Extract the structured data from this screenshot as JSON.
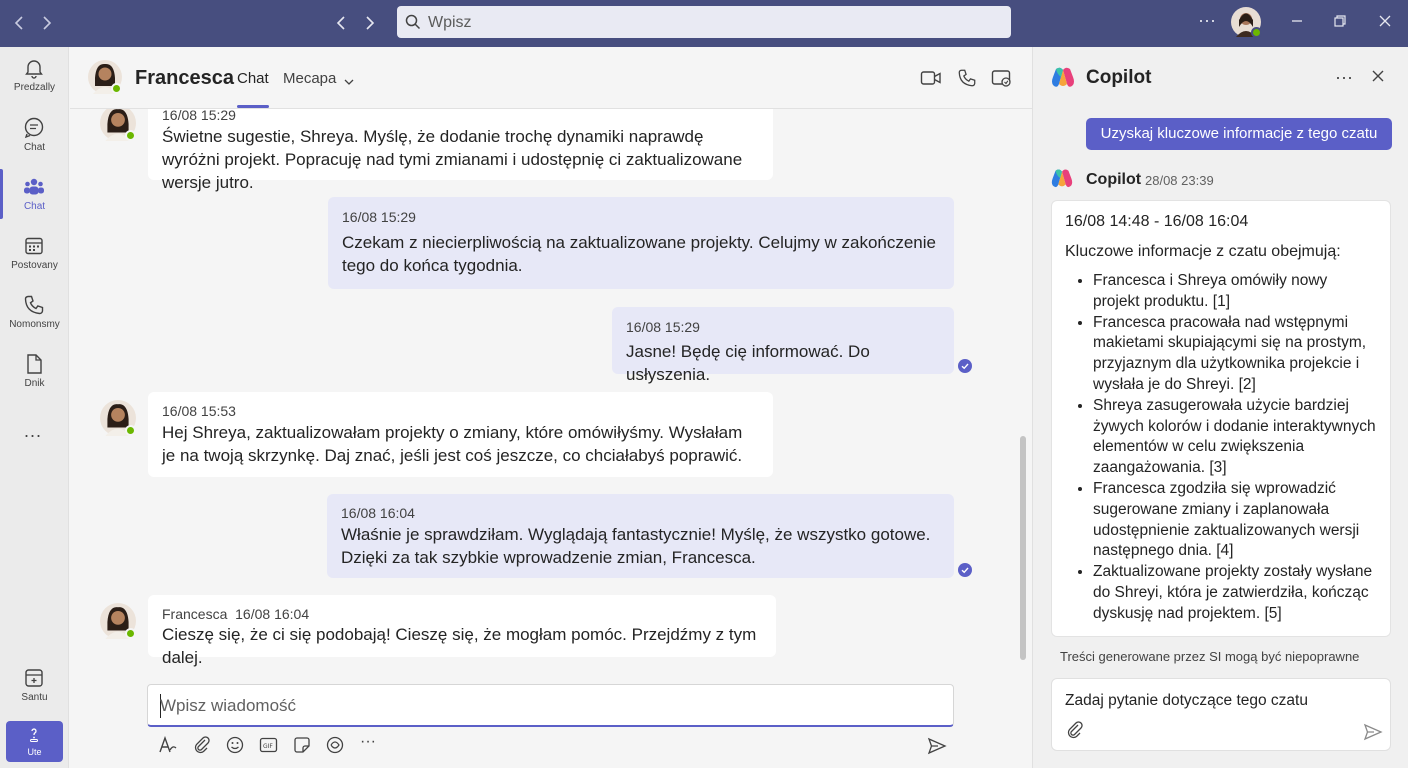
{
  "search": {
    "placeholder": "Wpisz"
  },
  "rail": {
    "items": [
      {
        "label": "Predzally",
        "icon": "bell-icon"
      },
      {
        "label": "Chat",
        "icon": "chat-bubble-icon"
      },
      {
        "label": "Chat",
        "icon": "people-icon",
        "active": true
      },
      {
        "label": "Postovany",
        "icon": "calendar-icon"
      },
      {
        "label": "Nomonsmy",
        "icon": "phone-icon"
      },
      {
        "label": "Dnik",
        "icon": "file-icon"
      }
    ],
    "more": "...",
    "bottom_item": {
      "label": "Santu",
      "icon": "store-icon"
    },
    "bottom_button": {
      "label": "Ute",
      "icon": "help-icon"
    }
  },
  "chat_header": {
    "name": "Francesca",
    "tabs": [
      {
        "label": "Chat",
        "active": true
      },
      {
        "label": "Mecapa",
        "dropdown": true
      }
    ]
  },
  "messages": [
    {
      "side": "in",
      "time": "16/08 15:29",
      "text": "Świetne sugestie, Shreya. Myślę, że dodanie trochę dynamiki naprawdę wyróżni projekt. Popracuję nad tymi zmianami i udostępnię ci zaktualizowane wersje jutro."
    },
    {
      "side": "out",
      "time": "16/08 15:29",
      "text": "Czekam z niecierpliwością na zaktualizowane projekty. Celujmy w zakończenie tego do końca tygodnia."
    },
    {
      "side": "out",
      "time": "16/08 15:29",
      "text": "Jasne! Będę cię informować. Do usłyszenia."
    },
    {
      "side": "in",
      "time": "16/08 15:53",
      "text": "Hej Shreya, zaktualizowałam projekty o zmiany, które omówiłyśmy. Wysłałam je na twoją skrzynkę. Daj znać, jeśli jest coś jeszcze, co chciałabyś poprawić."
    },
    {
      "side": "out",
      "time": "16/08 16:04",
      "text": "Właśnie je sprawdziłam. Wyglądają fantastycznie! Myślę, że wszystko gotowe. Dzięki za tak szybkie wprowadzenie zmian, Francesca."
    },
    {
      "side": "in",
      "sender": "Francesca",
      "time": "16/08 16:04",
      "text": "Cieszę się, że ci się podobają! Cieszę się, że mogłam pomóc. Przejdźmy z tym dalej."
    }
  ],
  "compose": {
    "placeholder": "Wpisz wiadomość"
  },
  "copilot": {
    "title": "Copilot",
    "suggestion": "Uzyskaj kluczowe informacje z tego czatu",
    "response_author": "Copilot",
    "response_time": "28/08 23:39",
    "range": "16/08 14:48 - 16/08 16:04",
    "intro": "Kluczowe informacje z czatu obejmują:",
    "bullets": [
      "Francesca i Shreya omówiły nowy projekt produktu. [1]",
      "Francesca pracowała nad wstępnymi makietami skupiającymi się na prostym, przyjaznym dla użytkownika projekcie i wysłała je do Shreyi. [2]",
      "Shreya zasugerowała użycie bardziej żywych kolorów i dodanie interaktywnych elementów w celu zwiększenia zaangażowania. [3]",
      "Francesca zgodziła się wprowadzić sugerowane zmiany i zaplanowała udostępnienie zaktualizowanych wersji następnego dnia. [4]",
      "Zaktualizowane projekty zostały wysłane do Shreyi, która je zatwierdziła, kończąc dyskusję nad projektem. [5]"
    ],
    "disclaimer": "Treści generowane przez SI mogą być niepoprawne",
    "ask_placeholder": "Zadaj pytanie dotyczące tego czatu"
  },
  "colors": {
    "titlebar": "#474e7f",
    "accent": "#5b5fc7",
    "outgoing_bubble": "#e7e8f7",
    "presence": "#6bb700"
  }
}
